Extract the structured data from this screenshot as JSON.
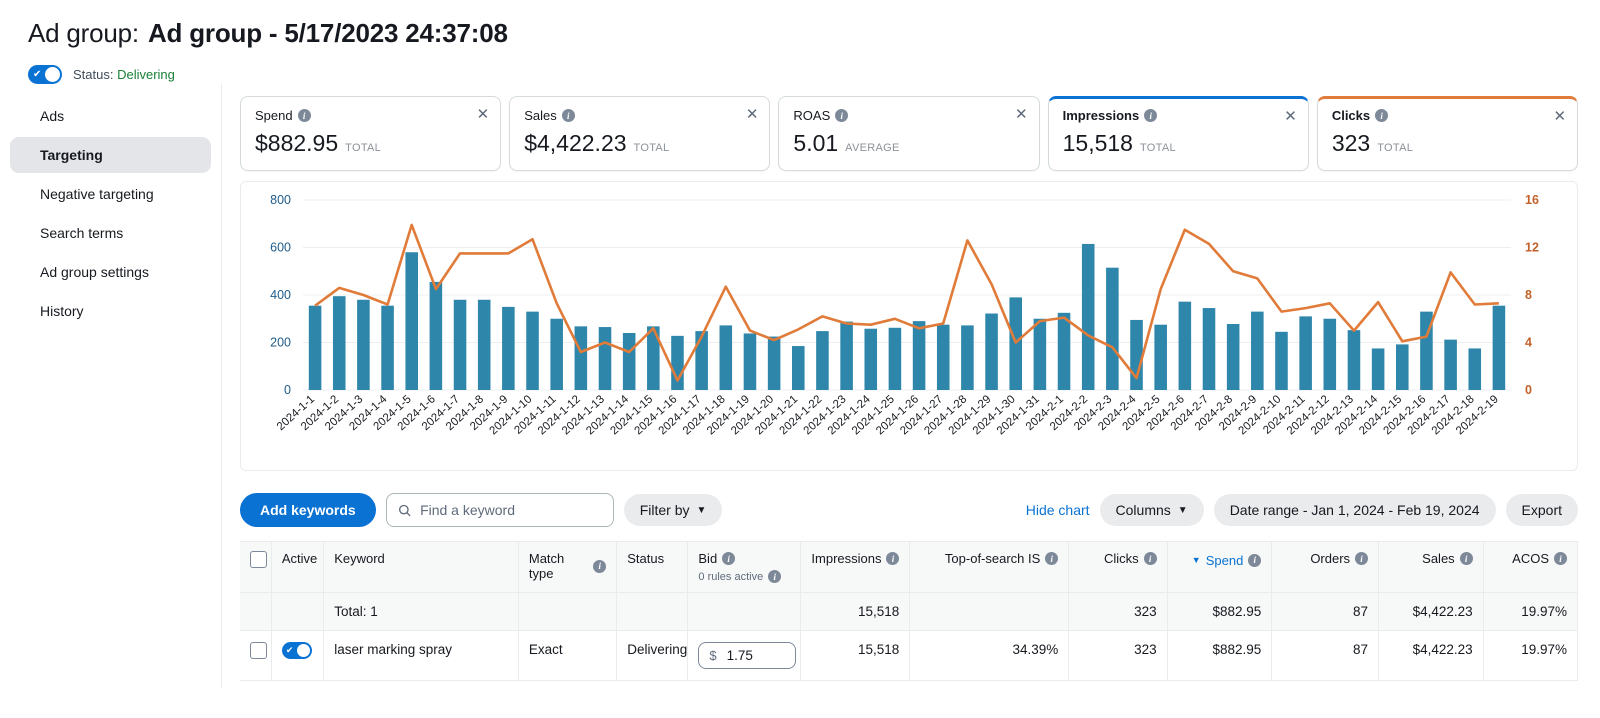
{
  "header": {
    "title_prefix": "Ad group:",
    "title_main": "Ad group - 5/17/2023 24:37:08",
    "status_label": "Status:",
    "status_value": "Delivering"
  },
  "sidebar": {
    "items": [
      {
        "label": "Ads",
        "active": false
      },
      {
        "label": "Targeting",
        "active": true
      },
      {
        "label": "Negative targeting",
        "active": false
      },
      {
        "label": "Search terms",
        "active": false
      },
      {
        "label": "Ad group settings",
        "active": false
      },
      {
        "label": "History",
        "active": false
      }
    ]
  },
  "metric_cards": [
    {
      "label": "Spend",
      "value": "$882.95",
      "unit": "TOTAL",
      "selected": "none",
      "accent": ""
    },
    {
      "label": "Sales",
      "value": "$4,422.23",
      "unit": "TOTAL",
      "selected": "none",
      "accent": ""
    },
    {
      "label": "ROAS",
      "value": "5.01",
      "unit": "AVERAGE",
      "selected": "none",
      "accent": ""
    },
    {
      "label": "Impressions",
      "value": "15,518",
      "unit": "TOTAL",
      "selected": "blue",
      "accent": "#0972d3"
    },
    {
      "label": "Clicks",
      "value": "323",
      "unit": "TOTAL",
      "selected": "orange",
      "accent": "#e07b39"
    }
  ],
  "chart_data": {
    "type": "bar",
    "title": "",
    "xlabel": "",
    "ylabel": "Impressions",
    "y2label": "Clicks",
    "ylim": [
      0,
      800
    ],
    "y2lim": [
      0,
      16
    ],
    "yticks": [
      0,
      200,
      400,
      600,
      800
    ],
    "y2ticks": [
      0,
      4,
      8,
      12,
      16
    ],
    "grid": true,
    "legend": "none",
    "bar_color": "#2e86ab",
    "line_color": "#e07b39",
    "categories": [
      "2024-1-1",
      "2024-1-2",
      "2024-1-3",
      "2024-1-4",
      "2024-1-5",
      "2024-1-6",
      "2024-1-7",
      "2024-1-8",
      "2024-1-9",
      "2024-1-10",
      "2024-1-11",
      "2024-1-12",
      "2024-1-13",
      "2024-1-14",
      "2024-1-15",
      "2024-1-16",
      "2024-1-17",
      "2024-1-18",
      "2024-1-19",
      "2024-1-20",
      "2024-1-21",
      "2024-1-22",
      "2024-1-23",
      "2024-1-24",
      "2024-1-25",
      "2024-1-26",
      "2024-1-27",
      "2024-1-28",
      "2024-1-29",
      "2024-1-30",
      "2024-1-31",
      "2024-2-1",
      "2024-2-2",
      "2024-2-3",
      "2024-2-4",
      "2024-2-5",
      "2024-2-6",
      "2024-2-7",
      "2024-2-8",
      "2024-2-9",
      "2024-2-10",
      "2024-2-11",
      "2024-2-12",
      "2024-2-13",
      "2024-2-14",
      "2024-2-15",
      "2024-2-16",
      "2024-2-17",
      "2024-2-18",
      "2024-2-19"
    ],
    "series": [
      {
        "name": "Impressions",
        "type": "bar",
        "axis": "left",
        "values": [
          355,
          395,
          380,
          355,
          580,
          455,
          380,
          380,
          350,
          330,
          300,
          268,
          265,
          240,
          268,
          228,
          248,
          272,
          238,
          225,
          185,
          248,
          288,
          258,
          262,
          290,
          275,
          272,
          322,
          390,
          300,
          325,
          615,
          515,
          295,
          275,
          372,
          345,
          278,
          330,
          245,
          310,
          300,
          252,
          175,
          192,
          330,
          212,
          175,
          355
        ]
      },
      {
        "name": "Clicks",
        "type": "line",
        "axis": "right",
        "values": [
          7.1,
          8.6,
          8.0,
          7.2,
          13.9,
          8.5,
          11.5,
          11.5,
          11.5,
          12.7,
          7.3,
          3.2,
          4.0,
          3.2,
          5.2,
          0.8,
          4.5,
          8.7,
          5.0,
          4.2,
          5.1,
          6.2,
          5.6,
          5.5,
          6.0,
          5.2,
          5.6,
          12.6,
          8.9,
          4.0,
          5.8,
          6.1,
          4.6,
          3.6,
          1.0,
          8.5,
          13.5,
          12.3,
          10.0,
          9.4,
          6.6,
          6.9,
          7.3,
          5.0,
          7.4,
          4.1,
          4.5,
          9.9,
          7.2,
          7.3
        ]
      }
    ]
  },
  "toolbar": {
    "add_keywords": "Add keywords",
    "search_placeholder": "Find a keyword",
    "search_value": "",
    "filter_by": "Filter by",
    "hide_chart": "Hide chart",
    "columns": "Columns",
    "date_range": "Date range - Jan 1, 2024 - Feb 19, 2024",
    "export": "Export"
  },
  "table": {
    "columns": [
      {
        "label": "",
        "key": "select",
        "align": "left",
        "info": false
      },
      {
        "label": "Active",
        "key": "active",
        "align": "left",
        "info": false
      },
      {
        "label": "Keyword",
        "key": "keyword",
        "align": "left",
        "info": false
      },
      {
        "label": "Match type",
        "key": "match_type",
        "align": "left",
        "info": true
      },
      {
        "label": "Status",
        "key": "status",
        "align": "left",
        "info": false
      },
      {
        "label": "Bid",
        "key": "bid",
        "align": "left",
        "info": true,
        "sub": "0 rules active"
      },
      {
        "label": "Impressions",
        "key": "impressions",
        "align": "right",
        "info": true
      },
      {
        "label": "Top-of-search IS",
        "key": "tos_is",
        "align": "right",
        "info": true
      },
      {
        "label": "Clicks",
        "key": "clicks",
        "align": "right",
        "info": true
      },
      {
        "label": "Spend",
        "key": "spend",
        "align": "right",
        "info": true,
        "sorted": true
      },
      {
        "label": "Orders",
        "key": "orders",
        "align": "right",
        "info": true
      },
      {
        "label": "Sales",
        "key": "sales",
        "align": "right",
        "info": true
      },
      {
        "label": "ACOS",
        "key": "acos",
        "align": "right",
        "info": true
      }
    ],
    "total_row": {
      "keyword": "Total: 1",
      "match_type": "",
      "status": "",
      "bid": "",
      "impressions": "15,518",
      "tos_is": "",
      "clicks": "323",
      "spend": "$882.95",
      "orders": "87",
      "sales": "$4,422.23",
      "acos": "19.97%"
    },
    "rows": [
      {
        "keyword": "laser marking spray",
        "match_type": "Exact",
        "status": "Delivering",
        "bid_currency": "$",
        "bid": "1.75",
        "impressions": "15,518",
        "tos_is": "34.39%",
        "clicks": "323",
        "spend": "$882.95",
        "orders": "87",
        "sales": "$4,422.23",
        "acos": "19.97%"
      }
    ]
  }
}
